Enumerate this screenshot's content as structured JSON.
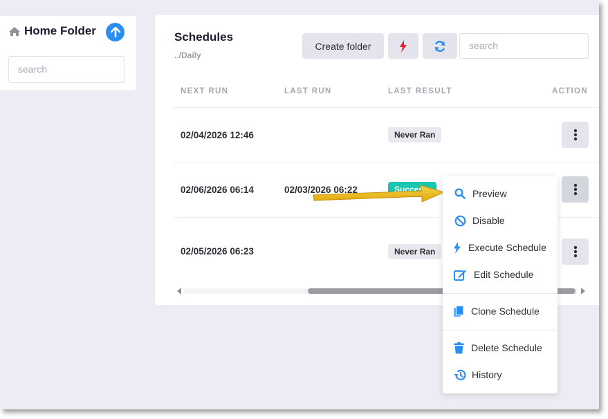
{
  "sidebar": {
    "title": "Home Folder",
    "search_placeholder": "search"
  },
  "main": {
    "title": "Schedules",
    "path": "../Daily",
    "toolbar": {
      "create_folder_label": "Create folder",
      "search_placeholder": "search"
    },
    "columns": [
      "NEXT RUN",
      "LAST RUN",
      "LAST RESULT",
      "ACTION"
    ],
    "rows": [
      {
        "next_run": "02/04/2026 12:46",
        "last_run": "",
        "last_result": "Never Ran"
      },
      {
        "next_run": "02/06/2026 06:14",
        "last_run": "02/03/2026 06:22",
        "last_result": "Success"
      },
      {
        "next_run": "02/05/2026 06:23",
        "last_run": "",
        "last_result": "Never Ran"
      }
    ]
  },
  "context_menu": {
    "items": [
      "Preview",
      "Disable",
      "Execute Schedule",
      "Edit Schedule",
      "Clone Schedule",
      "Delete Schedule",
      "History"
    ]
  },
  "colors": {
    "accent_blue": "#2b8ff2",
    "success_teal": "#1bc6b0",
    "flash_red": "#e8232b",
    "annotation_arrow": "#f2c21b"
  }
}
